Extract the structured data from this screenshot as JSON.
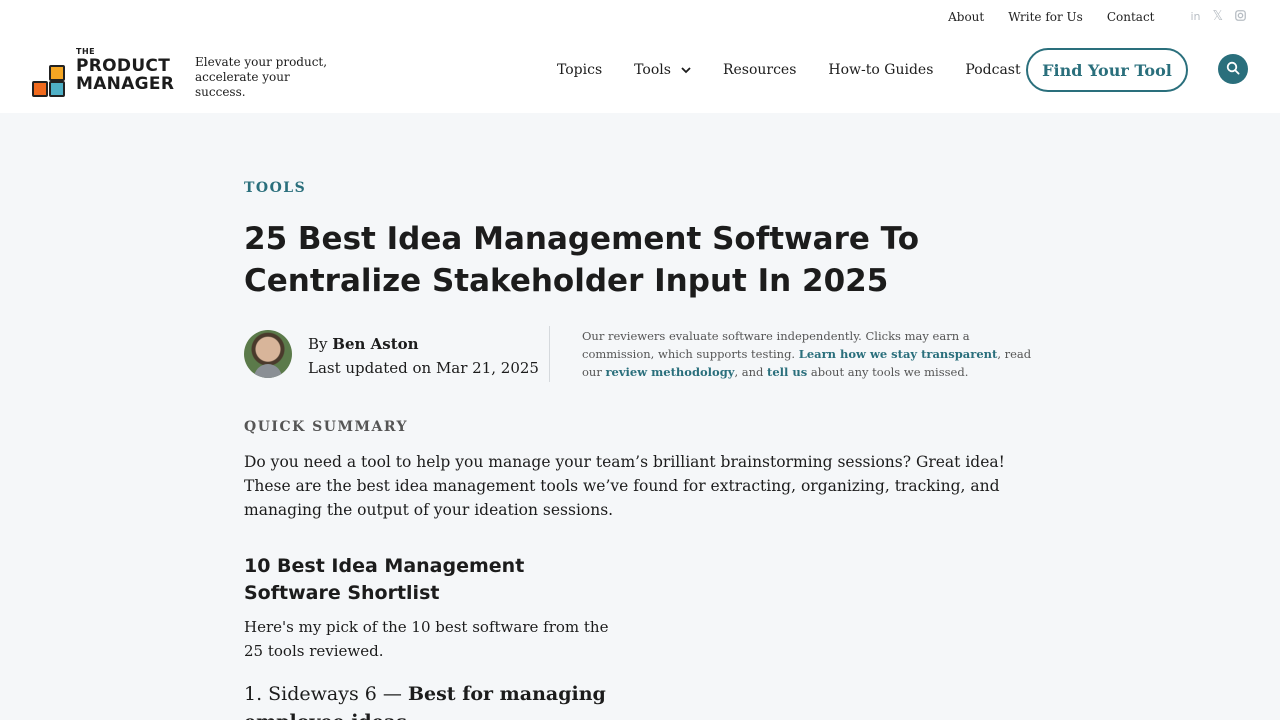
{
  "topnav": {
    "links": [
      "About",
      "Write for Us",
      "Contact"
    ],
    "social": [
      "linkedin-icon",
      "x-icon",
      "instagram-icon"
    ]
  },
  "logo": {
    "line0": "THE",
    "line1": "PRODUCT",
    "line2": "MANAGER"
  },
  "tagline": {
    "line1": "Elevate your product,",
    "line2": "accelerate your success."
  },
  "mainnav": {
    "topics": "Topics",
    "tools": "Tools",
    "resources": "Resources",
    "guides": "How-to Guides",
    "podcast": "Podcast"
  },
  "cta": {
    "find_tool": "Find Your Tool"
  },
  "article": {
    "category": "TOOLS",
    "title": "25 Best Idea Management Software To Centralize Stakeholder Input In 2025",
    "by_prefix": "By",
    "author": "Ben Aston",
    "updated": "Last updated on Mar 21, 2025",
    "disclaimer": {
      "part1": "Our reviewers evaluate software independently. Clicks may earn a commission, which supports testing. ",
      "link1": "Learn how we stay transparent",
      "part2": ", read our ",
      "link2": "review methodology",
      "part3": ", and ",
      "link3": "tell us",
      "part4": " about any tools we missed."
    },
    "summary_label": "QUICK SUMMARY",
    "summary_text": "Do you need a tool to help you manage your team’s brilliant brainstorming sessions? Great idea! These are the best idea management tools we’ve found for extracting, organizing, tracking, and managing the output of your ideation sessions.",
    "shortlist_title": "10 Best Idea Management Software Shortlist",
    "shortlist_text": "Here's my pick of the 10 best software from the 25 tools reviewed.",
    "pick1_name": "1. Sideways 6 — ",
    "pick1_best": "Best for managing employee ideas"
  },
  "colors": {
    "accent": "#2a6f7c",
    "background": "#f5f7f9"
  }
}
